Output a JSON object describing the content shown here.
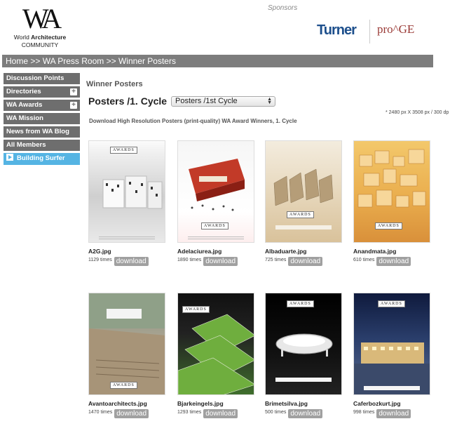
{
  "header": {
    "logo_mark": "WA",
    "logo_line1_pre": "World ",
    "logo_line1_bold": "Architecture",
    "logo_line2": "COMMUNITY",
    "sponsors_label": "Sponsors",
    "sponsor1": "Turner",
    "sponsor2": "pro^GE"
  },
  "breadcrumb": "Home  >>  WA Press Room  >>  Winner Posters",
  "sidebar": {
    "items": [
      {
        "label": "Discussion Points",
        "expandable": false
      },
      {
        "label": "Directories",
        "expandable": true
      },
      {
        "label": "WA Awards",
        "expandable": true
      },
      {
        "label": "WA Mission",
        "expandable": false
      },
      {
        "label": "News from WA Blog",
        "expandable": false
      },
      {
        "label": "All Members",
        "expandable": false
      }
    ],
    "building_surfer": "Building Surfer"
  },
  "main": {
    "section_title": "Winner Posters",
    "heading": "Posters /1. Cycle",
    "select_value": "Posters /1st Cycle",
    "resolution_note": "* 2480 px X 3508 px / 300 dp",
    "download_note": "Download High Resolution Posters (print-quality) WA Award Winners, 1. Cycle",
    "download_label": "download",
    "times_suffix": "times",
    "awards_mark": "AWARDS",
    "posters": [
      {
        "file": "A2G.jpg",
        "count": "1129"
      },
      {
        "file": "Adelaciurea.jpg",
        "count": "1890"
      },
      {
        "file": "Albaduarte.jpg",
        "count": "725"
      },
      {
        "file": "Anandmata.jpg",
        "count": "610"
      },
      {
        "file": "Avantoarchitects.jpg",
        "count": "1470"
      },
      {
        "file": "Bjarkeingels.jpg",
        "count": "1293"
      },
      {
        "file": "Brimetsilva.jpg",
        "count": "500"
      },
      {
        "file": "Caferbozkurt.jpg",
        "count": "998"
      }
    ]
  },
  "colors": {
    "bar_gray": "#7d7d7d",
    "sidebar_gray": "#6e6e6e",
    "surfer_blue": "#55b4e3",
    "turner_blue": "#1d4f8c",
    "proge_red": "#9a3a36"
  }
}
